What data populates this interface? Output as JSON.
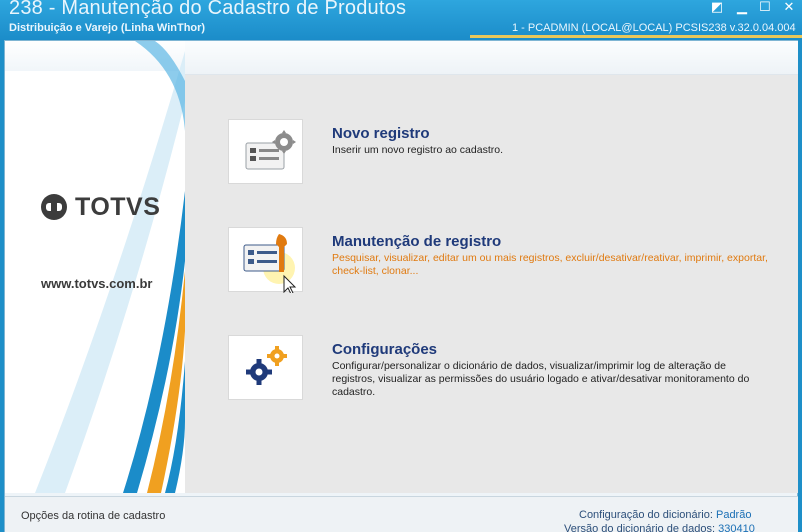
{
  "window": {
    "title": "238 - Manutenção do Cadastro de Produtos",
    "subtitle": "Distribuição e Varejo (Linha WinThor)",
    "session": "1 - PCADMIN (LOCAL@LOCAL)   PCSIS238  v.32.0.04.004",
    "controls": {
      "restore": "◩",
      "minimize": "▁",
      "maximize": "☐",
      "close": "✕"
    }
  },
  "brand": {
    "logo_text": "TOTVS",
    "url": "www.totvs.com.br",
    "colors": {
      "blue": "#1b8cc9",
      "orange": "#f0a020"
    }
  },
  "options": [
    {
      "icon": "new-record-card-gear-icon",
      "title": "Novo registro",
      "description": "Inserir um novo registro ao cadastro."
    },
    {
      "icon": "maintenance-card-wrench-icon",
      "title": "Manutenção de registro",
      "description": "Pesquisar, visualizar, editar um ou mais registros, excluir/desativar/reativar, imprimir, exportar, check-list,  clonar..."
    },
    {
      "icon": "settings-gears-icon",
      "title": "Configurações",
      "description": "Configurar/personalizar o dicionário de dados, visualizar/imprimir log de alteração de registros, visualizar as permissões do usuário logado e ativar/desativar monitoramento do cadastro."
    }
  ],
  "status": {
    "left": "Opções da rotina de cadastro",
    "dict_config_label": "Configuração do dicionário:",
    "dict_config_value": "Padrão",
    "dict_version_label": "Versão do dicionário de dados:",
    "dict_version_value": "330410"
  }
}
